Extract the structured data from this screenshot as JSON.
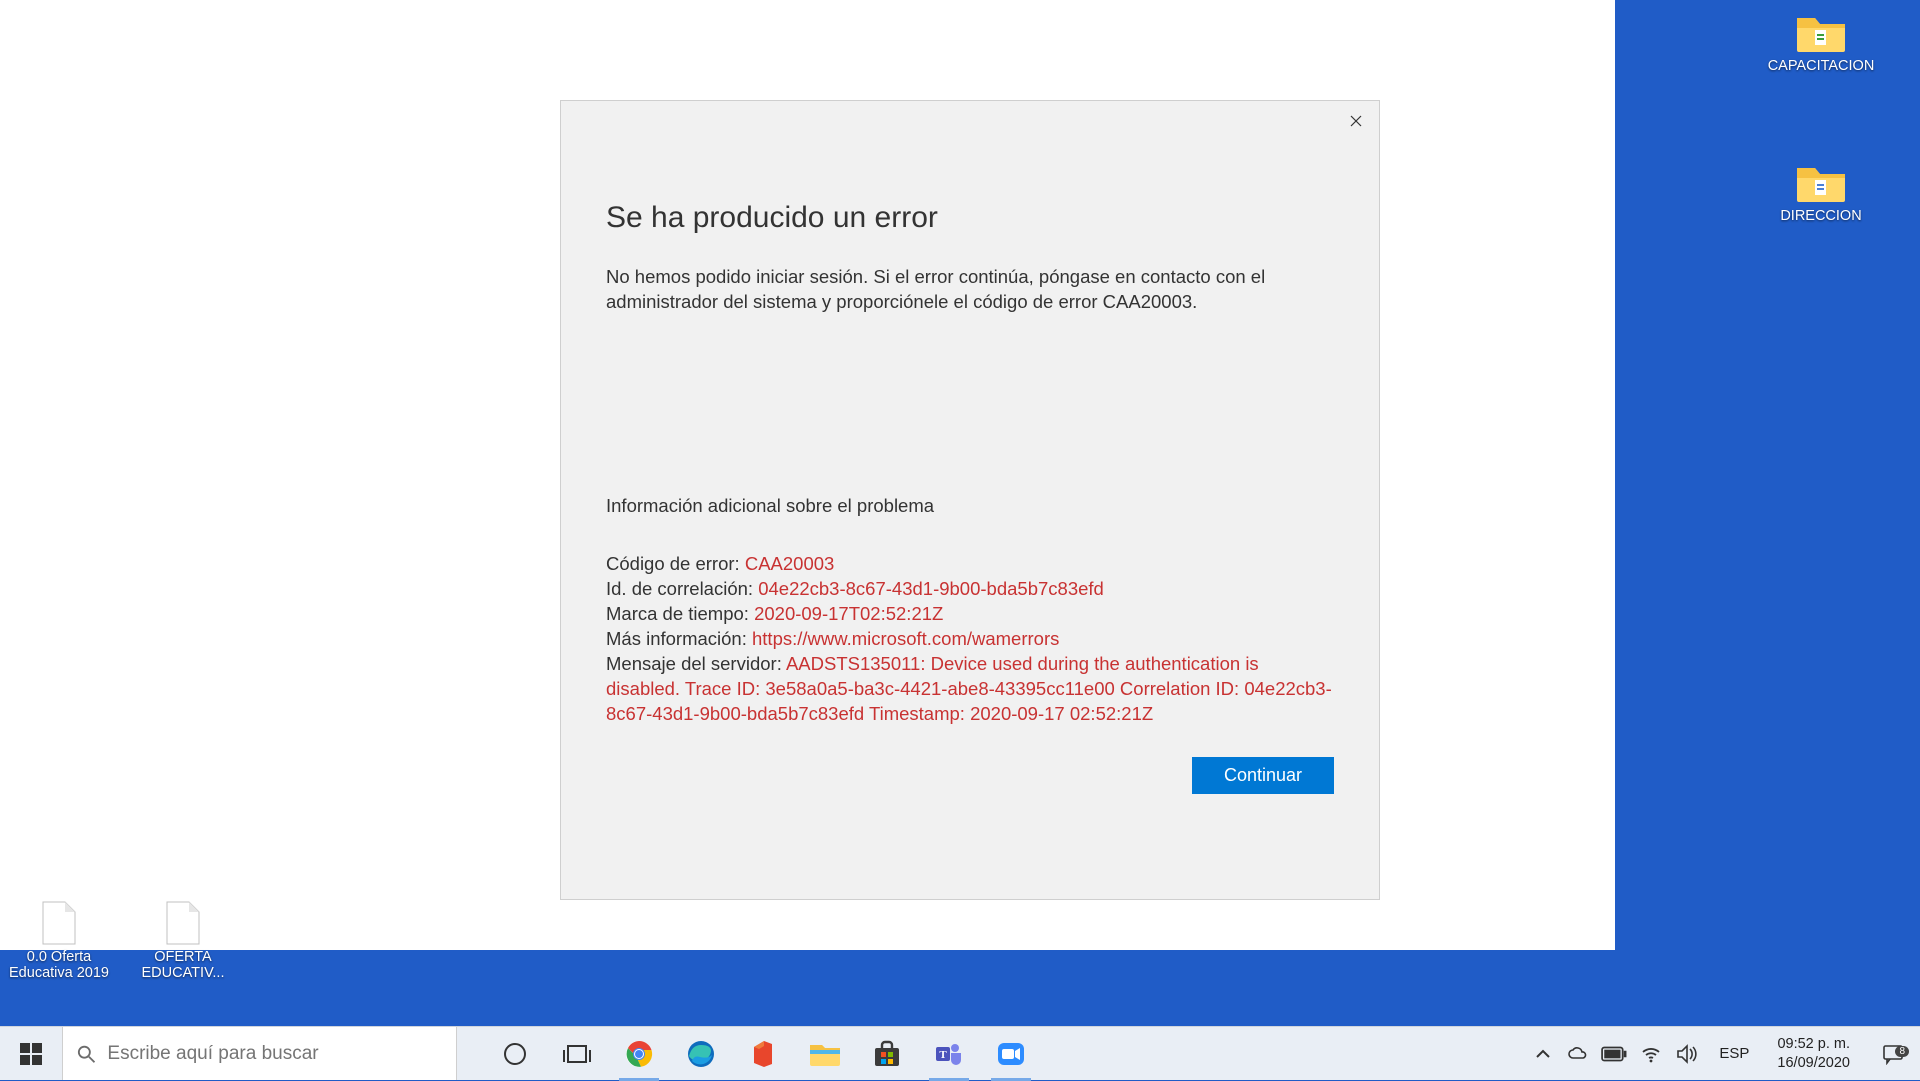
{
  "dialog": {
    "title": "Se ha producido un error",
    "message": "No hemos podido iniciar sesión. Si el error continúa, póngase en contacto con el administrador del sistema y proporciónele el código de error CAA20003.",
    "additional_header": "Información adicional sobre el problema",
    "fields": {
      "error_code_label": "Código de error: ",
      "error_code_value": "CAA20003",
      "correlation_label": "Id. de correlación: ",
      "correlation_value": "04e22cb3-8c67-43d1-9b00-bda5b7c83efd",
      "timestamp_label": "Marca de tiempo: ",
      "timestamp_value": "2020-09-17T02:52:21Z",
      "moreinfo_label": "Más información: ",
      "moreinfo_value": "https://www.microsoft.com/wamerrors",
      "server_label": "Mensaje del servidor: ",
      "server_value": "AADSTS135011: Device used during the authentication is disabled. Trace ID: 3e58a0a5-ba3c-4421-abe8-43395cc11e00 Correlation ID: 04e22cb3-8c67-43d1-9b00-bda5b7c83efd Timestamp: 2020-09-17 02:52:21Z"
    },
    "continue_label": "Continuar"
  },
  "desktop": {
    "icon1": "CAPACITACION",
    "icon2": "DIRECCION",
    "icon3": "0.0 Oferta Educativa 2019",
    "icon4": "OFERTA EDUCATIV..."
  },
  "taskbar": {
    "search_placeholder": "Escribe aquí para buscar",
    "lang": "ESP",
    "time": "09:52 p. m.",
    "date": "16/09/2020",
    "notif_count": "8"
  }
}
